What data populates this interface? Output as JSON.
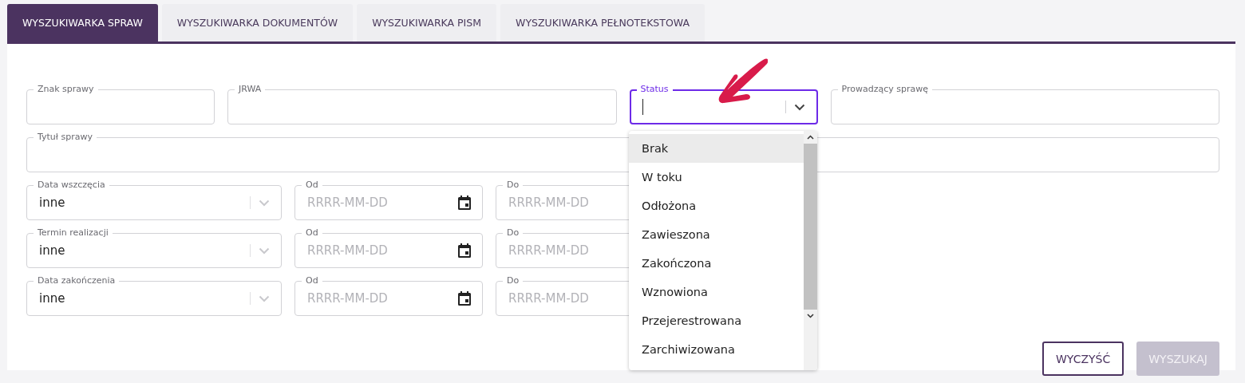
{
  "tabs": [
    {
      "label": "WYSZUKIWARKA SPRAW",
      "selected": true
    },
    {
      "label": "WYSZUKIWARKA DOKUMENTÓW",
      "selected": false
    },
    {
      "label": "WYSZUKIWARKA PISM",
      "selected": false
    },
    {
      "label": "WYSZUKIWARKA PEŁNOTEKSTOWA",
      "selected": false
    }
  ],
  "top_fields": [
    {
      "label": "Znak sprawy",
      "kind": "text"
    },
    {
      "label": "JRWA",
      "kind": "text"
    },
    {
      "label": "Status",
      "kind": "select",
      "focused": true
    },
    {
      "label": "Prowadzący sprawę",
      "kind": "text"
    }
  ],
  "title_field": {
    "label": "Tytuł sprawy"
  },
  "date_rows": [
    {
      "label": "Data wszczęcia",
      "value": "inne",
      "from": {
        "label": "Od",
        "placeholder": "RRRR-MM-DD"
      },
      "to": {
        "label": "Do",
        "placeholder": "RRRR-MM-DD"
      }
    },
    {
      "label": "Termin realizacji",
      "value": "inne",
      "from": {
        "label": "Od",
        "placeholder": "RRRR-MM-DD"
      },
      "to": {
        "label": "Do",
        "placeholder": "RRRR-MM-DD"
      }
    },
    {
      "label": "Data zakończenia",
      "value": "inne",
      "from": {
        "label": "Od",
        "placeholder": "RRRR-MM-DD"
      },
      "to": {
        "label": "Do",
        "placeholder": "RRRR-MM-DD"
      }
    }
  ],
  "status_options": [
    {
      "label": "Brak",
      "selected": true
    },
    {
      "label": "W toku",
      "selected": false
    },
    {
      "label": "Odłożona",
      "selected": false
    },
    {
      "label": "Zawieszona",
      "selected": false
    },
    {
      "label": "Zakończona",
      "selected": false
    },
    {
      "label": "Wznowiona",
      "selected": false
    },
    {
      "label": "Przejerestrowana",
      "selected": false
    },
    {
      "label": "Zarchiwizowana",
      "selected": false
    }
  ],
  "buttons": [
    {
      "label": "WYCZYŚĆ",
      "kind": "outline",
      "disabled": false
    },
    {
      "label": "WYSZUKAJ",
      "kind": "primary",
      "disabled": true
    }
  ]
}
